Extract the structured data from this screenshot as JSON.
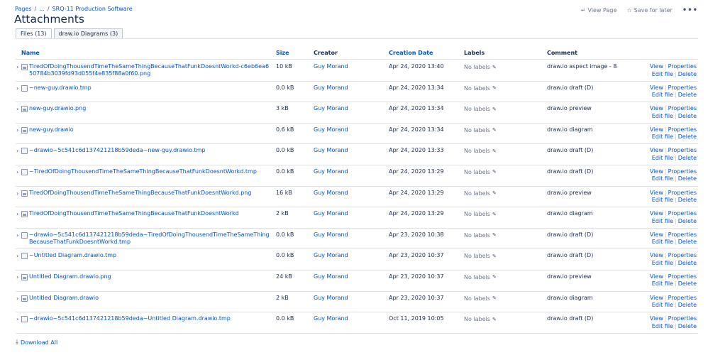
{
  "breadcrumb": {
    "pages": "Pages",
    "ellipsis": "...",
    "sep1": "/",
    "sep2": "/",
    "space": "SRQ-11 Production Software"
  },
  "title": "Attachments",
  "actions": {
    "view_page": "View Page",
    "save_for_later": "Save for later",
    "more": "•••"
  },
  "tabs": [
    {
      "label": "Files (13)",
      "active": true
    },
    {
      "label": "draw.io Diagrams (3)",
      "active": false
    }
  ],
  "columns": {
    "name": "Name",
    "size": "Size",
    "creator": "Creator",
    "date": "Creation Date",
    "labels": "Labels",
    "comment": "Comment"
  },
  "row_actions": {
    "view": "View",
    "properties": "Properties",
    "edit": "Edit file",
    "delete": "Delete",
    "sep": "|"
  },
  "no_labels": "No labels",
  "files": [
    {
      "name": "TiredOfDoingThousendTimeTheSameThingBecauseThatFunkDoesntWorkd-c6eb6ea650784b3039fd93d055f4e835f88a0f60.png",
      "size": "10 kB",
      "creator": "Guy Morand",
      "date": "Apr 24, 2020 13:40",
      "comment": "draw.io aspect image - 8",
      "icon": "image"
    },
    {
      "name": "~new-guy.drawio.tmp",
      "size": "0.0 kB",
      "creator": "Guy Morand",
      "date": "Apr 24, 2020 13:34",
      "comment": "draw.io draft (D)",
      "icon": "file"
    },
    {
      "name": "new-guy.drawio.png",
      "size": "3 kB",
      "creator": "Guy Morand",
      "date": "Apr 24, 2020 13:34",
      "comment": "draw.io preview",
      "icon": "image"
    },
    {
      "name": "new-guy.drawio",
      "size": "0.6 kB",
      "creator": "Guy Morand",
      "date": "Apr 24, 2020 13:34",
      "comment": "draw.io diagram",
      "icon": "image"
    },
    {
      "name": "~drawio~5c541c6d137421218b59deda~new-guy.drawio.tmp",
      "size": "0.0 kB",
      "creator": "Guy Morand",
      "date": "Apr 24, 2020 13:33",
      "comment": "draw.io draft (D)",
      "icon": "file"
    },
    {
      "name": "~TiredOfDoingThousendTimeTheSameThingBecauseThatFunkDoesntWorkd.tmp",
      "size": "0.0 kB",
      "creator": "Guy Morand",
      "date": "Apr 24, 2020 13:29",
      "comment": "draw.io draft (D)",
      "icon": "file"
    },
    {
      "name": "TiredOfDoingThousendTimeTheSameThingBecauseThatFunkDoesntWorkd.png",
      "size": "16 kB",
      "creator": "Guy Morand",
      "date": "Apr 24, 2020 13:29",
      "comment": "draw.io preview",
      "icon": "image"
    },
    {
      "name": "TiredOfDoingThousendTimeTheSameThingBecauseThatFunkDoesntWorkd",
      "size": "2 kB",
      "creator": "Guy Morand",
      "date": "Apr 24, 2020 13:29",
      "comment": "draw.io diagram",
      "icon": "image"
    },
    {
      "name": "~drawio~5c541c6d137421218b59deda~TiredOfDoingThousendTimeTheSameThingBecauseThatFunkDoesntWorkd.tmp",
      "size": "0.0 kB",
      "creator": "Guy Morand",
      "date": "Apr 23, 2020 10:38",
      "comment": "draw.io draft (D)",
      "icon": "file"
    },
    {
      "name": "~Untitled Diagram.drawio.tmp",
      "size": "0.0 kB",
      "creator": "Guy Morand",
      "date": "Apr 23, 2020 10:37",
      "comment": "draw.io draft (D)",
      "icon": "file"
    },
    {
      "name": "Untitled Diagram.drawio.png",
      "size": "24 kB",
      "creator": "Guy Morand",
      "date": "Apr 23, 2020 10:37",
      "comment": "draw.io preview",
      "icon": "image"
    },
    {
      "name": "Untitled Diagram.drawio",
      "size": "2 kB",
      "creator": "Guy Morand",
      "date": "Apr 23, 2020 10:37",
      "comment": "draw.io diagram",
      "icon": "image"
    },
    {
      "name": "~drawio~5c541c6d137421218b59deda~Untitled Diagram.drawio.tmp",
      "size": "0.0 kB",
      "creator": "Guy Morand",
      "date": "Oct 11, 2019 10:05",
      "comment": "draw.io draft (D)",
      "icon": "file"
    }
  ],
  "download_all": "Download All"
}
